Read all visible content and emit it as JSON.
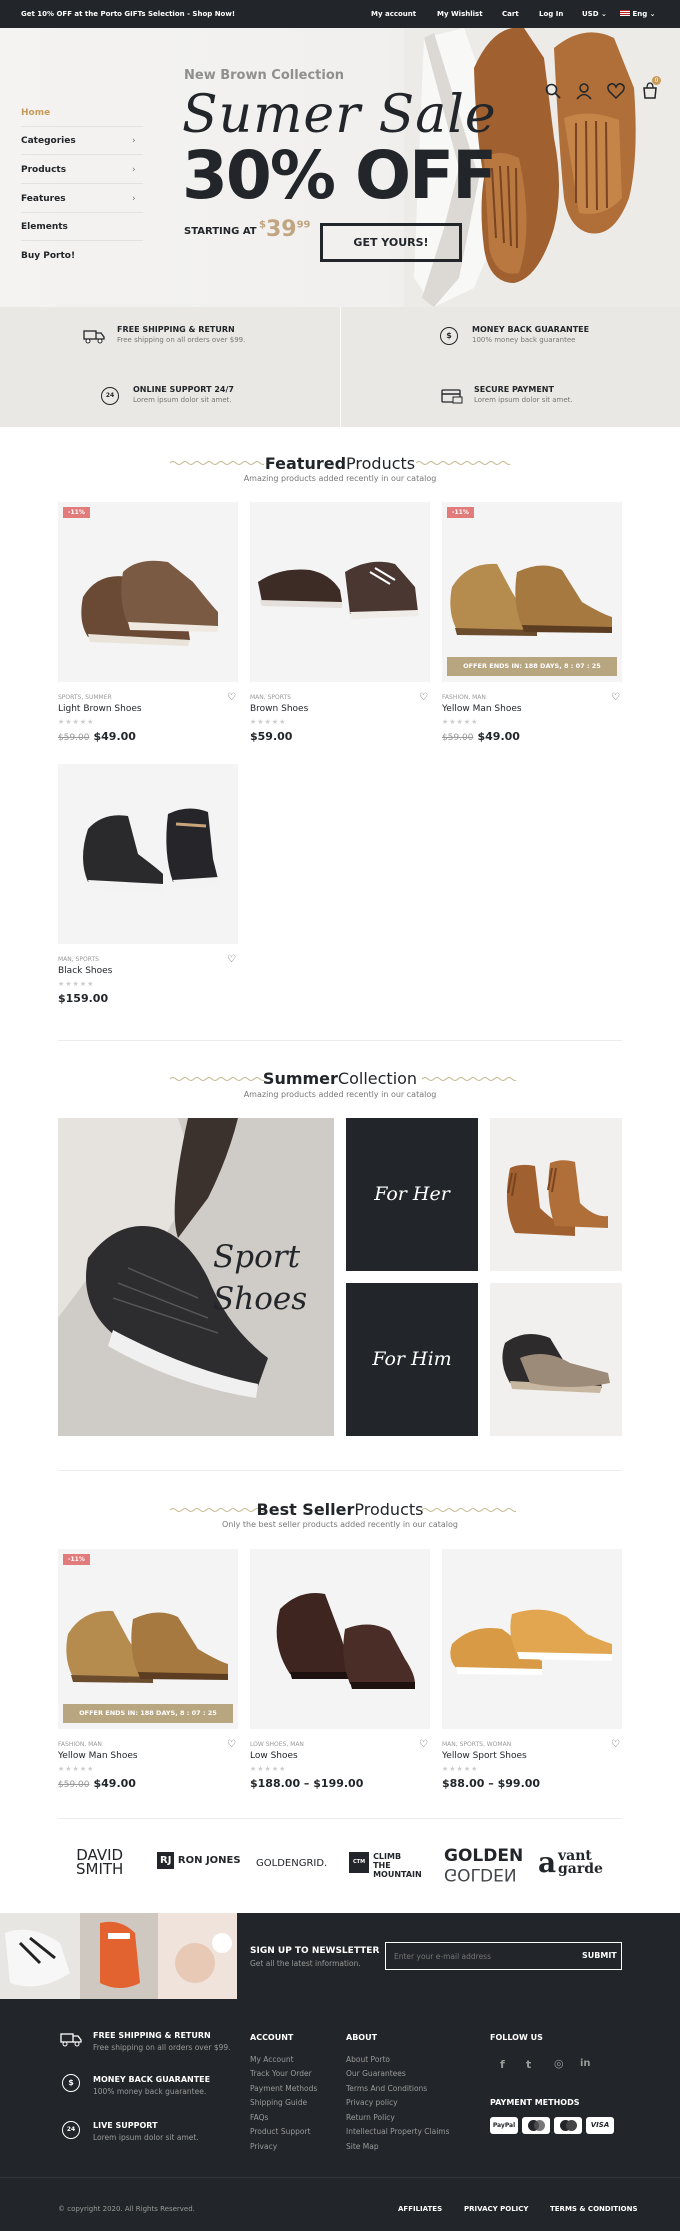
{
  "topbar": {
    "promo": "Get 10% OFF at the Porto GIFTs Selection - ",
    "promo_bold": "Shop Now!",
    "links": [
      "My account",
      "My Wishlist",
      "Cart",
      "Log In"
    ],
    "currency": "USD",
    "language": "Eng"
  },
  "header": {
    "cart_count": "0"
  },
  "sidebar": {
    "items": [
      {
        "label": "Home",
        "active": true
      },
      {
        "label": "Categories"
      },
      {
        "label": "Products"
      },
      {
        "label": "Features"
      },
      {
        "label": "Elements"
      },
      {
        "label": "Buy Porto!"
      }
    ]
  },
  "hero": {
    "eyebrow": "New Brown Collection",
    "headline": "Sumer Sale",
    "discount": "30% OFF",
    "starting_label": "STARTING AT",
    "price_currency": "$",
    "price_whole": "39",
    "price_cents": "99",
    "cta": "GET YOURS!"
  },
  "features": [
    {
      "title": "FREE SHIPPING & RETURN",
      "sub": "Free shipping on all orders over $99.",
      "icon": "truck-icon"
    },
    {
      "title": "MONEY BACK GUARANTEE",
      "sub": "100% money back guarantee",
      "icon": "dollar-icon"
    },
    {
      "title": "ONLINE SUPPORT 24/7",
      "sub": "Lorem ipsum dolor sit amet.",
      "icon": "support-24-icon"
    },
    {
      "title": "SECURE PAYMENT",
      "sub": "Lorem ipsum dolor sit amet.",
      "icon": "card-icon"
    }
  ],
  "featured": {
    "title_bold": "Featured",
    "title_rest": "Products",
    "subtitle": "Amazing products added recently in our catalog",
    "products": [
      {
        "cat": "SPORTS, SUMMER",
        "name": "Light Brown Shoes",
        "old": "$59.00",
        "price": "$49.00",
        "badge": "-11%"
      },
      {
        "cat": "MAN, SPORTS",
        "name": "Brown Shoes",
        "old": "",
        "price": "$59.00",
        "badge": ""
      },
      {
        "cat": "FASHION, MAN",
        "name": "Yellow Man Shoes",
        "old": "$59.00",
        "price": "$49.00",
        "badge": "-11%",
        "offer": "OFFER ENDS IN: 188 DAYS, 8 : 07 : 25"
      },
      {
        "cat": "MAN, SPORTS",
        "name": "Black Shoes",
        "old": "",
        "price": "$159.00",
        "badge": ""
      }
    ]
  },
  "summer": {
    "title_bold": "Summer",
    "title_rest": "Collection",
    "subtitle": "Amazing products added recently in our catalog",
    "big_tile": "Sport Shoes",
    "her": "For Her",
    "him": "For Him"
  },
  "bestseller": {
    "title_bold": "Best Seller",
    "title_rest": "Products",
    "subtitle": "Only the best seller products added recently in our catalog",
    "products": [
      {
        "cat": "FASHION, MAN",
        "name": "Yellow Man Shoes",
        "old": "$59.00",
        "price": "$49.00",
        "badge": "-11%",
        "offer": "OFFER ENDS IN: 188 DAYS, 8 : 07 : 25"
      },
      {
        "cat": "LOW SHOES, MAN",
        "name": "Low Shoes",
        "old": "",
        "price": "$188.00 – $199.00",
        "badge": ""
      },
      {
        "cat": "MAN, SPORTS, WOMAN",
        "name": "Yellow Sport Shoes",
        "old": "",
        "price": "$88.00 – $99.00",
        "badge": ""
      }
    ]
  },
  "brands": {
    "david_1": "DAVID",
    "david_2": "SMITH",
    "rj": "RJ",
    "ronjones": "RON JONES",
    "golden_grid": "GOLDENGRID.",
    "ctm_badge": "CTM",
    "ctm_1": "CLIMB",
    "ctm_2": "THE",
    "ctm_3": "MOUNTAIN",
    "golden_1": "GOLDEN",
    "golden_2": "GOLDEN",
    "vant_a": "a",
    "vant_1": "vant",
    "vant_2": "garde"
  },
  "newsletter": {
    "title": "SIGN UP TO NEWSLETTER",
    "sub": "Get all the latest information.",
    "placeholder": "Enter your e-mail address",
    "button": "SUBMIT"
  },
  "footer": {
    "features": [
      {
        "title": "FREE SHIPPING & RETURN",
        "sub": "Free shipping on all orders over $99."
      },
      {
        "title": "MONEY BACK GUARANTEE",
        "sub": "100% money back guarantee."
      },
      {
        "title": "LIVE SUPPORT",
        "sub": "Lorem ipsum dolor sit amet."
      }
    ],
    "account_title": "ACCOUNT",
    "account_links": [
      "My Account",
      "Track Your Order",
      "Payment Methods",
      "Shipping Guide",
      "FAQs",
      "Product Support",
      "Privacy"
    ],
    "about_title": "ABOUT",
    "about_links": [
      "About Porto",
      "Our Guarantees",
      "Terms And Conditions",
      "Privacy policy",
      "Return Policy",
      "Intellectual Property Claims",
      "Site Map"
    ],
    "follow_title": "FOLLOW US",
    "social": [
      "f",
      "t",
      "◎",
      "in"
    ],
    "payment_title": "PAYMENT METHODS",
    "payments": [
      "PayPal",
      "stripe",
      "",
      "VISA"
    ],
    "copyright": "© copyright 2020. All Rights Reserved.",
    "bottom_links": [
      "AFFILIATES",
      "PRIVACY POLICY",
      "TERMS & CONDITIONS"
    ]
  },
  "colors": {
    "dark": "#222529",
    "accent": "#c89b59",
    "offer": "#b8a681",
    "badge": "#e27c7c"
  }
}
